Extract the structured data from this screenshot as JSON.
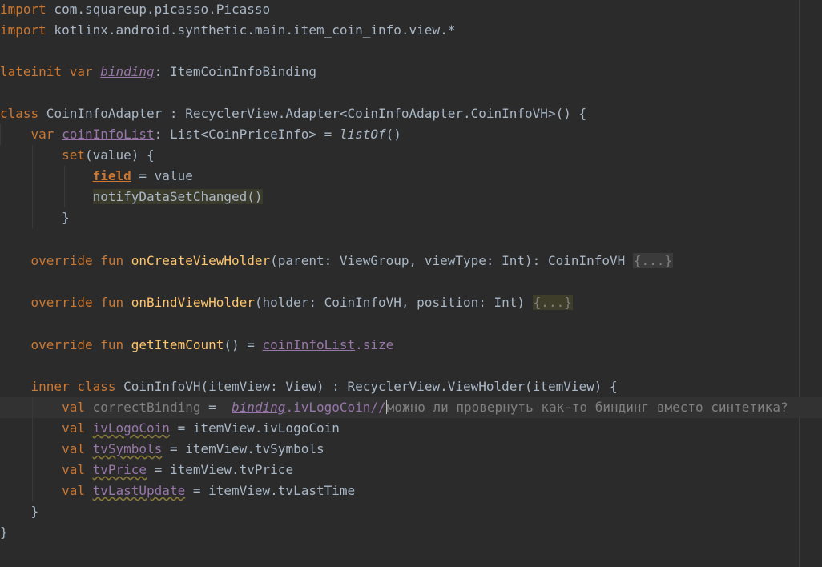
{
  "editor": {
    "language": "Kotlin",
    "colors": {
      "background": "#2b2b2b",
      "keyword": "#cc7832",
      "function": "#ffc66d",
      "property": "#9876aa",
      "text": "#a9b7c6",
      "comment": "#808080"
    },
    "lines": {
      "l1": {
        "kw": "import",
        "rest": " com.squareup.picasso.Picasso"
      },
      "l2": {
        "kw": "import",
        "rest": " kotlinx.android.synthetic.main.item_coin_info.view.*"
      },
      "l4": {
        "kw": "lateinit var",
        "name": "binding",
        "rest": ": ItemCoinInfoBinding"
      },
      "l6": {
        "kw": "class",
        "rest": " CoinInfoAdapter : RecyclerView.Adapter<CoinInfoAdapter.CoinInfoVH>() {"
      },
      "l7": {
        "kw": "var",
        "name": "coinInfoList",
        "rest1": ": List<CoinPriceInfo> = ",
        "call": "listOf",
        "rest2": "()"
      },
      "l8": {
        "kw": "set",
        "rest": "(value) {"
      },
      "l9": {
        "name": "field",
        "rest": " = value"
      },
      "l10": {
        "call": "notifyDataSetChanged()"
      },
      "l11": {
        "rest": "}"
      },
      "l13": {
        "kw": "override fun",
        "fn": "onCreateViewHolder",
        "rest": "(parent: ViewGroup, viewType: Int): CoinInfoVH ",
        "fold": "{...}"
      },
      "l15": {
        "kw": "override fun",
        "fn": "onBindViewHolder",
        "rest": "(holder: CoinInfoVH, position: Int) ",
        "fold": "{...}"
      },
      "l17": {
        "kw": "override fun",
        "fn": "getItemCount",
        "rest": "() = ",
        "name": "coinInfoList",
        "prop": ".size"
      },
      "l19": {
        "kw": "inner class",
        "rest": " CoinInfoVH(itemView: View) : RecyclerView.ViewHolder(itemView) {"
      },
      "l20": {
        "kw": "val",
        "name": "correctBinding",
        "rest": " =  ",
        "ref": "binding",
        "rest2": ".ivLogoCoin//",
        "comment": "можно ли провернуть как-то биндинг вместо синтетика?"
      },
      "l21": {
        "kw": "val",
        "name": "ivLogoCoin",
        "rest": " = itemView.ivLogoCoin"
      },
      "l22": {
        "kw": "val",
        "name": "tvSymbols",
        "rest": " = itemView.tvSymbols"
      },
      "l23": {
        "kw": "val",
        "name": "tvPrice",
        "rest": " = itemView.tvPrice"
      },
      "l24": {
        "kw": "val",
        "name": "tvLastUpdate",
        "rest": " = itemView.tvLastTime"
      },
      "l25": {
        "rest": "}"
      },
      "l26": {
        "rest": "}"
      }
    }
  }
}
